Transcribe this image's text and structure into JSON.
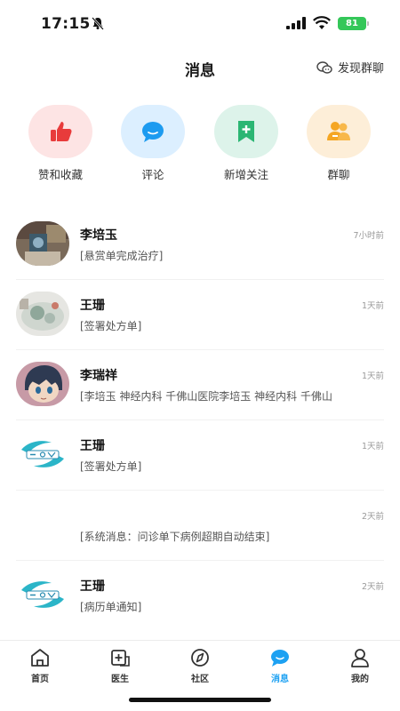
{
  "status_bar": {
    "time": "17:15",
    "battery": "81"
  },
  "header": {
    "title": "消息",
    "discover_label": "发现群聊"
  },
  "quick_actions": [
    {
      "label": "赞和收藏",
      "icon": "thumbs-up-icon",
      "bg": "#fde4e4",
      "color": "#e83b3b"
    },
    {
      "label": "评论",
      "icon": "comment-bubble-icon",
      "bg": "#dcefff",
      "color": "#1d9bf0"
    },
    {
      "label": "新增关注",
      "icon": "follow-plus-icon",
      "bg": "#ddf3ea",
      "color": "#2bb673"
    },
    {
      "label": "群聊",
      "icon": "group-icon",
      "bg": "#fdeed8",
      "color": "#f5a623"
    }
  ],
  "messages": [
    {
      "name": "李培玉",
      "time": "7小时前",
      "preview": "[悬赏单完成治疗]",
      "avatar": "photo-avatar"
    },
    {
      "name": "王珊",
      "time": "1天前",
      "preview": "[签署处方单]",
      "avatar": "photo-avatar"
    },
    {
      "name": "李瑞祥",
      "time": "1天前",
      "preview": "[李培玉 神经内科 千佛山医院李培玉 神经内科 千佛山",
      "avatar": "cartoon-avatar"
    },
    {
      "name": "王珊",
      "time": "1天前",
      "preview": "[签署处方单]",
      "avatar": "logo-avatar"
    },
    {
      "name": "",
      "time": "2天前",
      "preview": "[系统消息：问诊单下病例超期自动结束]",
      "avatar": ""
    },
    {
      "name": "王珊",
      "time": "2天前",
      "preview": "[病历单通知]",
      "avatar": "logo-avatar"
    }
  ],
  "tabs": [
    {
      "label": "首页",
      "icon": "home-icon"
    },
    {
      "label": "医生",
      "icon": "doctor-icon"
    },
    {
      "label": "社区",
      "icon": "compass-icon"
    },
    {
      "label": "消息",
      "icon": "message-icon",
      "active": true
    },
    {
      "label": "我的",
      "icon": "profile-icon"
    }
  ],
  "colors": {
    "accent": "#1da1f2"
  }
}
